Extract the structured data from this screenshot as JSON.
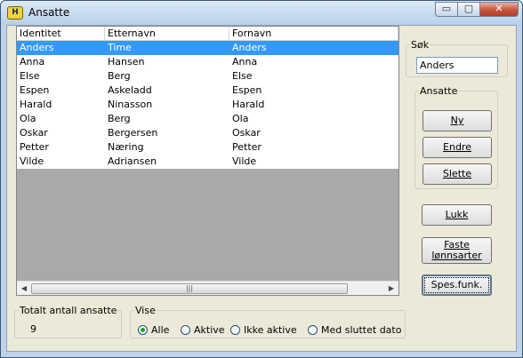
{
  "window": {
    "title": "Ansatte",
    "icon": "H"
  },
  "titlebar": {
    "min": "▭",
    "max": "▢",
    "close": "✕"
  },
  "grid": {
    "columns": [
      "Identitet",
      "Etternavn",
      "Fornavn"
    ],
    "rows": [
      [
        "Anders",
        "Time",
        "Anders"
      ],
      [
        "Anna",
        "Hansen",
        "Anna"
      ],
      [
        "Else",
        "Berg",
        "Else"
      ],
      [
        "Espen",
        "Askeladd",
        "Espen"
      ],
      [
        "Harald",
        "Ninasson",
        "Harald"
      ],
      [
        "Ola",
        "Berg",
        "Ola"
      ],
      [
        "Oskar",
        "Bergersen",
        "Oskar"
      ],
      [
        "Petter",
        "Næring",
        "Petter"
      ],
      [
        "Vilde",
        "Adriansen",
        "Vilde"
      ]
    ],
    "selected_index": 0
  },
  "search": {
    "legend": "Søk",
    "value": "Anders"
  },
  "ansatte_group": {
    "legend": "Ansatte",
    "ny": "Ny",
    "endre": "Endre",
    "slette": "Slette"
  },
  "buttons": {
    "lukk": "Lukk",
    "faste": "Faste lønnsarter",
    "spes": "Spes.funk."
  },
  "total": {
    "legend": "Totalt antall ansatte",
    "value": "9"
  },
  "vise": {
    "legend": "Vise",
    "options": [
      "Alle",
      "Aktive",
      "Ikke aktive",
      "Med sluttet dato"
    ],
    "selected": "Alle"
  }
}
